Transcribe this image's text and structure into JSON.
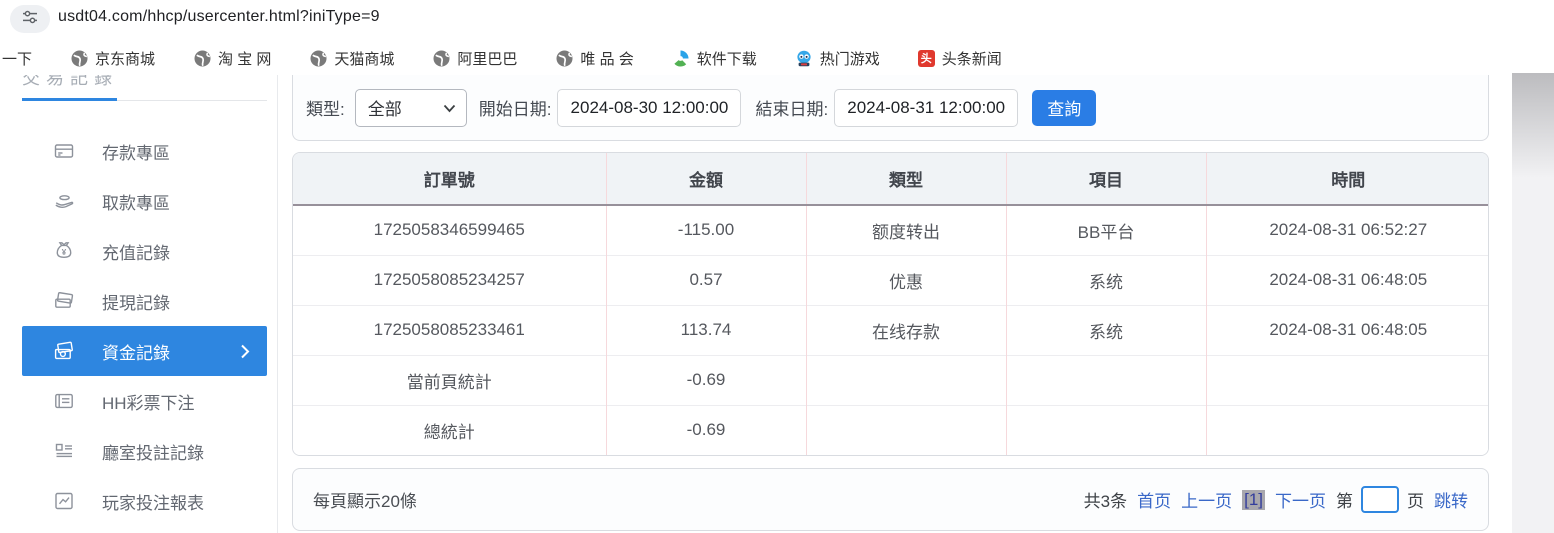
{
  "browser": {
    "url": "usdt04.com/hhcp/usercenter.html?iniType=9",
    "bookmarks": [
      {
        "id": "search-partial",
        "label": "一下",
        "icon": "none"
      },
      {
        "id": "jd-mall",
        "label": "京东商城",
        "icon": "globe"
      },
      {
        "id": "taobao",
        "label": "淘 宝 网",
        "icon": "globe"
      },
      {
        "id": "tmall",
        "label": "天猫商城",
        "icon": "globe"
      },
      {
        "id": "alibaba",
        "label": "阿里巴巴",
        "icon": "globe"
      },
      {
        "id": "vip",
        "label": "唯 品 会",
        "icon": "globe"
      },
      {
        "id": "software-download",
        "label": "软件下载",
        "icon": "software"
      },
      {
        "id": "hot-games",
        "label": "热门游戏",
        "icon": "game"
      },
      {
        "id": "toutiao-news",
        "label": "头条新闻",
        "icon": "toutiao",
        "badge": "头"
      }
    ]
  },
  "sidebar": {
    "clipped_tab_text": "交易記錄",
    "items": [
      {
        "id": "deposit-zone",
        "label": "存款專區",
        "icon": "deposit-card-icon",
        "active": false
      },
      {
        "id": "withdraw-zone",
        "label": "取款專區",
        "icon": "withdraw-hand-icon",
        "active": false
      },
      {
        "id": "recharge-records",
        "label": "充值記錄",
        "icon": "moneybag-icon",
        "active": false
      },
      {
        "id": "withdrawal-records",
        "label": "提現記錄",
        "icon": "cards-icon",
        "active": false
      },
      {
        "id": "funds-records",
        "label": "資金記錄",
        "icon": "wallet-icon",
        "active": true,
        "chevron": true
      },
      {
        "id": "hh-lottery-bets",
        "label": "HH彩票下注",
        "icon": "ticket-icon",
        "active": false
      },
      {
        "id": "room-bet-records",
        "label": "廳室投註記錄",
        "icon": "grid-icon",
        "active": false
      },
      {
        "id": "player-bet-report",
        "label": "玩家投注報表",
        "icon": "report-icon",
        "active": false
      }
    ]
  },
  "filters": {
    "type_label": "類型:",
    "type_value": "全部",
    "start_label": "開始日期:",
    "start_value": "2024-08-30 12:00:00",
    "end_label": "結束日期:",
    "end_value": "2024-08-31 12:00:00",
    "search_button": "查詢"
  },
  "table": {
    "headers": [
      "訂單號",
      "金額",
      "類型",
      "項目",
      "時間"
    ],
    "rows": [
      [
        "1725058346599465",
        "-115.00",
        "额度转出",
        "BB平台",
        "2024-08-31 06:52:27"
      ],
      [
        "1725058085234257",
        "0.57",
        "优惠",
        "系统",
        "2024-08-31 06:48:05"
      ],
      [
        "1725058085233461",
        "113.74",
        "在线存款",
        "系统",
        "2024-08-31 06:48:05"
      ],
      [
        "當前頁統計",
        "-0.69",
        "",
        "",
        ""
      ],
      [
        "總統計",
        "-0.69",
        "",
        "",
        ""
      ]
    ]
  },
  "pagination": {
    "page_size_text": "每頁顯示20條",
    "total_text": "共3条",
    "first": "首页",
    "prev": "上一页",
    "current": "[1]",
    "next": "下一页",
    "jump_prefix": "第",
    "jump_input_value": "",
    "jump_suffix": "页",
    "jump_button": "跳转"
  },
  "colors": {
    "accent_blue": "#2e86e0",
    "button_blue": "#2a7de5",
    "link_blue": "#3a68c8",
    "table_divider_pink": "#f6d9dc",
    "header_bg": "#f0f3f6",
    "toutiao_red": "#e0392e"
  }
}
